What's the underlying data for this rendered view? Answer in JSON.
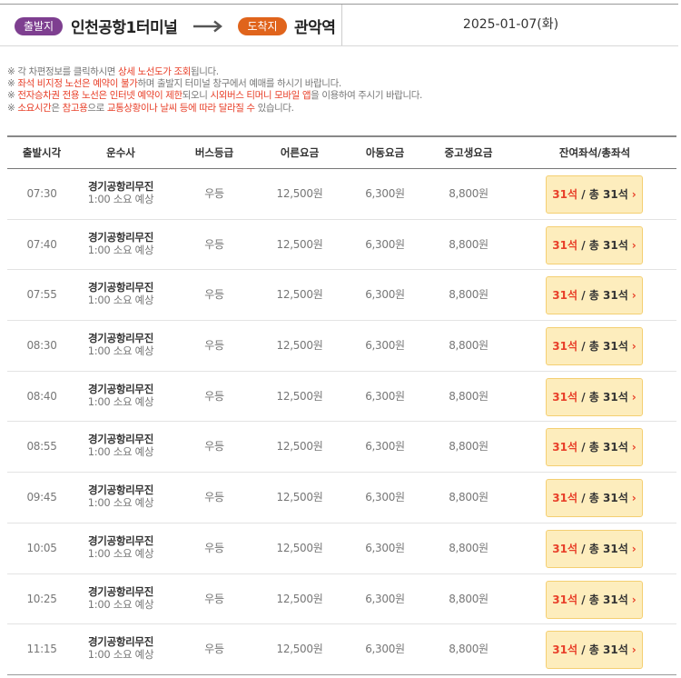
{
  "route": {
    "departure_badge": "출발지",
    "departure": "인천공항1터미널",
    "arrival_badge": "도착지",
    "arrival": "관악역",
    "date": "2025-01-07(화)"
  },
  "notes": [
    [
      {
        "t": "※ 각 차편정보를 클릭하시면 ",
        "red": false
      },
      {
        "t": "상세 노선도가 조회",
        "red": true
      },
      {
        "t": "됩니다.",
        "red": false
      }
    ],
    [
      {
        "t": "※ ",
        "red": false
      },
      {
        "t": "좌석 비지정 노선은 예약이 불가",
        "red": true
      },
      {
        "t": "하며 출발지 터미널 창구에서 예매를 하시기 바랍니다.",
        "red": false
      }
    ],
    [
      {
        "t": "※ ",
        "red": false
      },
      {
        "t": "전자승차권 전용 노선은 인터넷 예약이 제한",
        "red": true
      },
      {
        "t": "되오니 ",
        "red": false
      },
      {
        "t": "시외버스 티머니 모바일 앱",
        "red": true
      },
      {
        "t": "을 이용하여 주시기 바랍니다.",
        "red": false
      }
    ],
    [
      {
        "t": "※ ",
        "red": false
      },
      {
        "t": "소요시간",
        "red": true
      },
      {
        "t": "은 ",
        "red": false
      },
      {
        "t": "참고용",
        "red": true
      },
      {
        "t": "으로 ",
        "red": false
      },
      {
        "t": "교통상황이나 날씨 등에 따라 달라질 수",
        "red": true
      },
      {
        "t": " 있습니다.",
        "red": false
      }
    ]
  ],
  "table": {
    "headers": [
      "출발시각",
      "운수사",
      "버스등급",
      "어른요금",
      "아동요금",
      "중고생요금",
      "잔여좌석/총좌석"
    ],
    "rows": [
      {
        "time": "07:30",
        "carrier": "경기공항리무진",
        "duration": "1:00 소요 예상",
        "grade": "우등",
        "adult": "12,500원",
        "child": "6,300원",
        "teen": "8,800원",
        "remaining": "31석",
        "total": "/ 총 31석"
      },
      {
        "time": "07:40",
        "carrier": "경기공항리무진",
        "duration": "1:00 소요 예상",
        "grade": "우등",
        "adult": "12,500원",
        "child": "6,300원",
        "teen": "8,800원",
        "remaining": "31석",
        "total": "/ 총 31석"
      },
      {
        "time": "07:55",
        "carrier": "경기공항리무진",
        "duration": "1:00 소요 예상",
        "grade": "우등",
        "adult": "12,500원",
        "child": "6,300원",
        "teen": "8,800원",
        "remaining": "31석",
        "total": "/ 총 31석"
      },
      {
        "time": "08:30",
        "carrier": "경기공항리무진",
        "duration": "1:00 소요 예상",
        "grade": "우등",
        "adult": "12,500원",
        "child": "6,300원",
        "teen": "8,800원",
        "remaining": "31석",
        "total": "/ 총 31석"
      },
      {
        "time": "08:40",
        "carrier": "경기공항리무진",
        "duration": "1:00 소요 예상",
        "grade": "우등",
        "adult": "12,500원",
        "child": "6,300원",
        "teen": "8,800원",
        "remaining": "31석",
        "total": "/ 총 31석"
      },
      {
        "time": "08:55",
        "carrier": "경기공항리무진",
        "duration": "1:00 소요 예상",
        "grade": "우등",
        "adult": "12,500원",
        "child": "6,300원",
        "teen": "8,800원",
        "remaining": "31석",
        "total": "/ 총 31석"
      },
      {
        "time": "09:45",
        "carrier": "경기공항리무진",
        "duration": "1:00 소요 예상",
        "grade": "우등",
        "adult": "12,500원",
        "child": "6,300원",
        "teen": "8,800원",
        "remaining": "31석",
        "total": "/ 총 31석"
      },
      {
        "time": "10:05",
        "carrier": "경기공항리무진",
        "duration": "1:00 소요 예상",
        "grade": "우등",
        "adult": "12,500원",
        "child": "6,300원",
        "teen": "8,800원",
        "remaining": "31석",
        "total": "/ 총 31석"
      },
      {
        "time": "10:25",
        "carrier": "경기공항리무진",
        "duration": "1:00 소요 예상",
        "grade": "우등",
        "adult": "12,500원",
        "child": "6,300원",
        "teen": "8,800원",
        "remaining": "31석",
        "total": "/ 총 31석"
      },
      {
        "time": "11:15",
        "carrier": "경기공항리무진",
        "duration": "1:00 소요 예상",
        "grade": "우등",
        "adult": "12,500원",
        "child": "6,300원",
        "teen": "8,800원",
        "remaining": "31석",
        "total": "/ 총 31석"
      }
    ]
  },
  "icons": {
    "route_arrow": "arrow-right-icon",
    "seat_chevron": "chevron-right-icon"
  },
  "colors": {
    "departure_badge": "#7e3f90",
    "arrival_badge": "#e0641c",
    "highlight_red": "#e8402a",
    "seat_button_bg": "#fdedbd"
  }
}
